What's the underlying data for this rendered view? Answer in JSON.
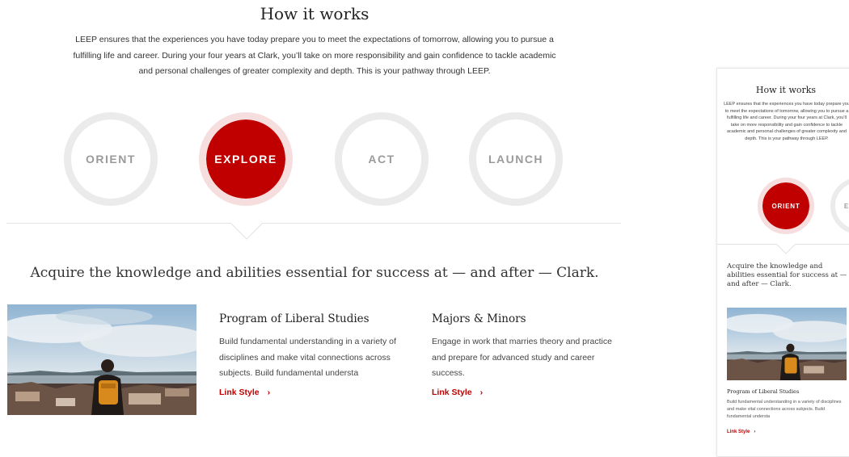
{
  "section": {
    "title": "How it works",
    "intro": "LEEP ensures that the experiences you have today prepare you to meet the expectations of tomorrow, allowing you to pursue a fulfilling life and career. During your four years at Clark, you’ll take on more responsibility and gain confidence to tackle academic and personal challenges of greater complexity and depth. This is your pathway through LEEP.",
    "steps": [
      "ORIENT",
      "EXPLORE",
      "ACT",
      "LAUNCH"
    ],
    "active_step": "EXPLORE",
    "subtitle": "Acquire the knowledge and abilities essential for success at — and after — Clark.",
    "cards": [
      {
        "title": "Program of Liberal Studies",
        "body": "Build fundamental understanding in a variety of disciplines and make vital connections across subjects.  Build fundamental understa",
        "link": "Link Style"
      },
      {
        "title": "Majors & Minors",
        "body": "Engage in work that marries theory and practice and prepare for advanced study and career success.",
        "link": "Link Style"
      }
    ]
  },
  "mobile": {
    "title": "How it works",
    "intro": "LEEP ensures that the experiences you have today prepare you to meet the expectations of tomorrow, allowing you to pursue a fulfilling life and career. During your four years at Clark, you’ll take on more responsibility and gain confidence to tackle academic and personal challenges of greater complexity and depth. This is your pathway through LEEP.",
    "active_step": "ORIENT",
    "next_step_partial": "E",
    "subtitle": "Acquire the knowledge and abilities essential for success at — and after — Clark.",
    "card_title": "Program of Liberal Studies",
    "card_body": "Build fundamental understanding in a variety of disciplines and make vital connections across subjects.  Build fundamental understa",
    "link": "Link Style"
  },
  "icons": {
    "link_chevron": "chevron-right-icon",
    "link_glyph": "›"
  },
  "colors": {
    "accent": "#c00000",
    "ring": "#ebebeb",
    "active_ring": "#f6dede"
  }
}
